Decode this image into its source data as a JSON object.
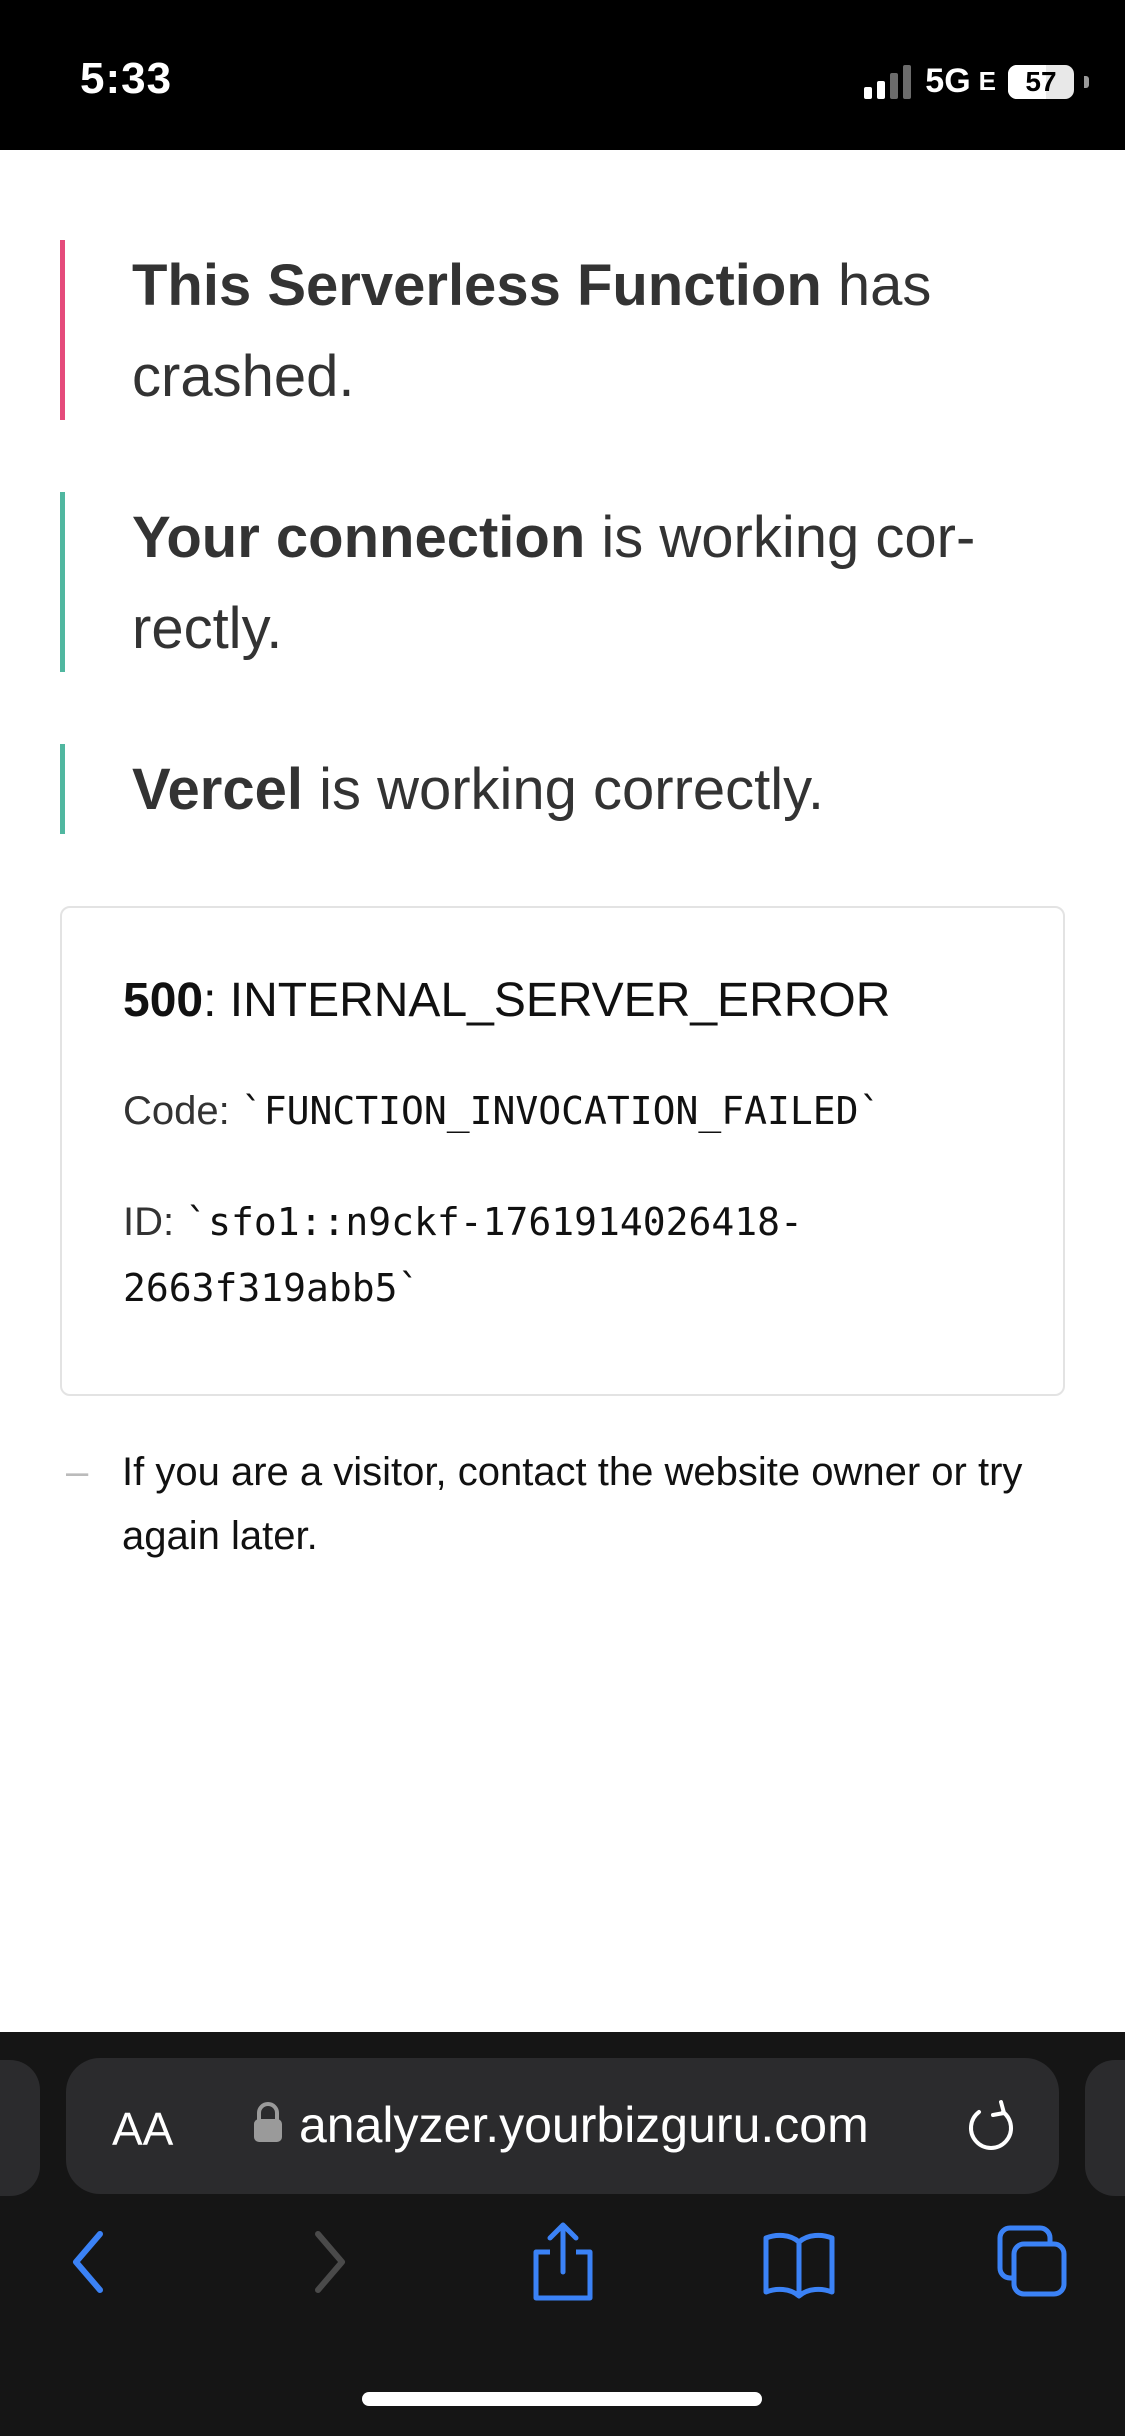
{
  "status_bar": {
    "time": "5:33",
    "network": "5G",
    "network_suffix": "E",
    "battery": "57",
    "battery_level": 0.57
  },
  "notices": {
    "function": {
      "bold": "This Serverless Function",
      "rest": " has crashed.",
      "color": "#e54b7b"
    },
    "connection": {
      "bold": "Your connection",
      "rest": " is working cor-rectly.",
      "color": "#50b7a0"
    },
    "vercel": {
      "bold": "Vercel",
      "rest": " is working correctly.",
      "color": "#50b7a0"
    }
  },
  "error": {
    "status_code": "500",
    "status_name": ": INTERNAL_SERVER_ERROR",
    "code_label": "Code: ",
    "code_value": "`FUNCTION_INVOCATION_FAILED`",
    "id_label": "ID: ",
    "id_value": "`sfo1::n9ckf-1761914026418-2663f319abb5`"
  },
  "help": {
    "dash": "–",
    "text": "If you are a visitor, contact the website owner or try again later."
  },
  "safari": {
    "text_size_button": "AA",
    "url": "analyzer.yourbizguru.com",
    "icons": [
      "lock-icon",
      "reload-icon",
      "back-icon",
      "forward-icon",
      "share-icon",
      "bookmarks-icon",
      "tabs-icon"
    ],
    "accent_color": "#3b82f6"
  }
}
